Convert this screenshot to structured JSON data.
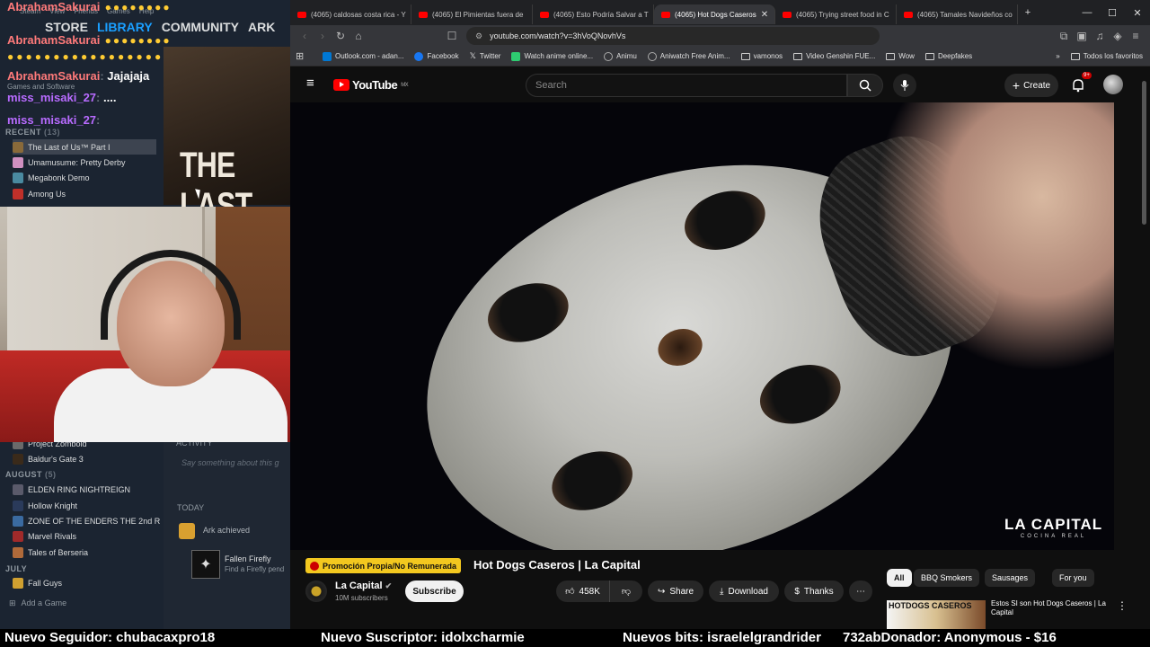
{
  "steam": {
    "top_items": [
      "Steam",
      "View",
      "Friends",
      "Games",
      "Help"
    ],
    "nav": [
      "STORE",
      "LIBRARY",
      "COMMUNITY",
      "ARK"
    ],
    "chat": [
      {
        "user": "AbrahamSakurai",
        "msg": ""
      },
      {
        "user": "AbrahamSakurai",
        "msg": ""
      },
      {
        "user": "AbrahamSakurai",
        "msg": "Jajajaja"
      },
      {
        "user": "miss_misaki_27",
        "msg": "...."
      },
      {
        "user": "miss_misaki_27",
        "msg": ""
      }
    ],
    "games_and_software": "Games and Software",
    "recent_label": "RECENT",
    "recent_count": "(13)",
    "recent": [
      "The Last of Us™ Part I",
      "Umamusume: Pretty Derby",
      "Megabonk Demo",
      "Among Us"
    ],
    "mid_games": [
      "Project Zomboid",
      "Baldur's Gate 3"
    ],
    "august_label": "AUGUST",
    "august_count": "(5)",
    "august": [
      "ELDEN RING NIGHTREIGN",
      "Hollow Knight",
      "ZONE OF THE ENDERS THE 2nd R",
      "Marvel Rivals",
      "Tales of Berseria"
    ],
    "july_label": "JULY",
    "july": [
      "Fall Guys"
    ],
    "add_game": "Add a Game",
    "art_title": "THE LAST",
    "activity_label": "ACTIVITY",
    "activity_placeholder": "Say something about this g",
    "today_label": "TODAY",
    "ark_achieved": "Ark achieved",
    "achievement_name": "Fallen Firefly",
    "achievement_desc": "Find a Firefly pend"
  },
  "browser": {
    "tabs": [
      {
        "label": "(4065) caldosas costa rica - Y",
        "active": false
      },
      {
        "label": "(4065) El Pimientas fuera de",
        "active": false
      },
      {
        "label": "(4065) Esto Podría Salvar a T",
        "active": false
      },
      {
        "label": "(4065) Hot Dogs Caseros",
        "active": true
      },
      {
        "label": "(4065) Trying street food in C",
        "active": false
      },
      {
        "label": "(4065) Tamales Navideños co",
        "active": false
      }
    ],
    "url": "youtube.com/watch?v=3hVoQNovhVs",
    "bookmarks": [
      {
        "label": "Outlook.com - adan...",
        "color": "#0078d4"
      },
      {
        "label": "Facebook",
        "color": "#1877f2"
      },
      {
        "label": "Twitter",
        "color": "#000000"
      },
      {
        "label": "Watch anime online...",
        "color": "#2ecc71"
      },
      {
        "label": "Animu",
        "color": "#888888"
      },
      {
        "label": "Aniwatch Free Anim...",
        "color": "#666666"
      }
    ],
    "folders": [
      "vamonos",
      "Video Genshin FUE...",
      "Wow",
      "Deepfakes"
    ],
    "all_bookmarks": "Todos los favoritos"
  },
  "youtube": {
    "logo": "YouTube",
    "region": "MX",
    "search_placeholder": "Search",
    "create": "Create",
    "notif_badge": "9+",
    "watermark_main": "LA CAPITAL",
    "watermark_sub": "COCINA REAL",
    "promo": "Promoción Propia/No Remunerada",
    "title": "Hot Dogs Caseros | La Capital",
    "channel": "La Capital",
    "subscribers": "10M subscribers",
    "subscribe": "Subscribe",
    "likes": "458K",
    "share": "Share",
    "download": "Download",
    "thanks": "Thanks",
    "chips": [
      "All",
      "BBQ Smokers",
      "Sausages",
      "For you"
    ],
    "rec_thumb_text": "HOTDOGS CASEROS",
    "rec_title": "Estos SI son Hot Dogs Caseros | La Capital"
  },
  "ticker": {
    "follower": "Nuevo Seguidor: chubacaxpro18",
    "subscriber": "Nuevo Suscriptor: idolxcharmie",
    "bits": "Nuevos bits: israelelgrandrider",
    "overlap": "732abDonador: Anonymous - $16"
  },
  "colors": {
    "yt_red": "#ff0000",
    "promo_yellow": "#f3c81f",
    "steam_blue": "#1a9fff",
    "steam_bg": "#1b2431"
  }
}
